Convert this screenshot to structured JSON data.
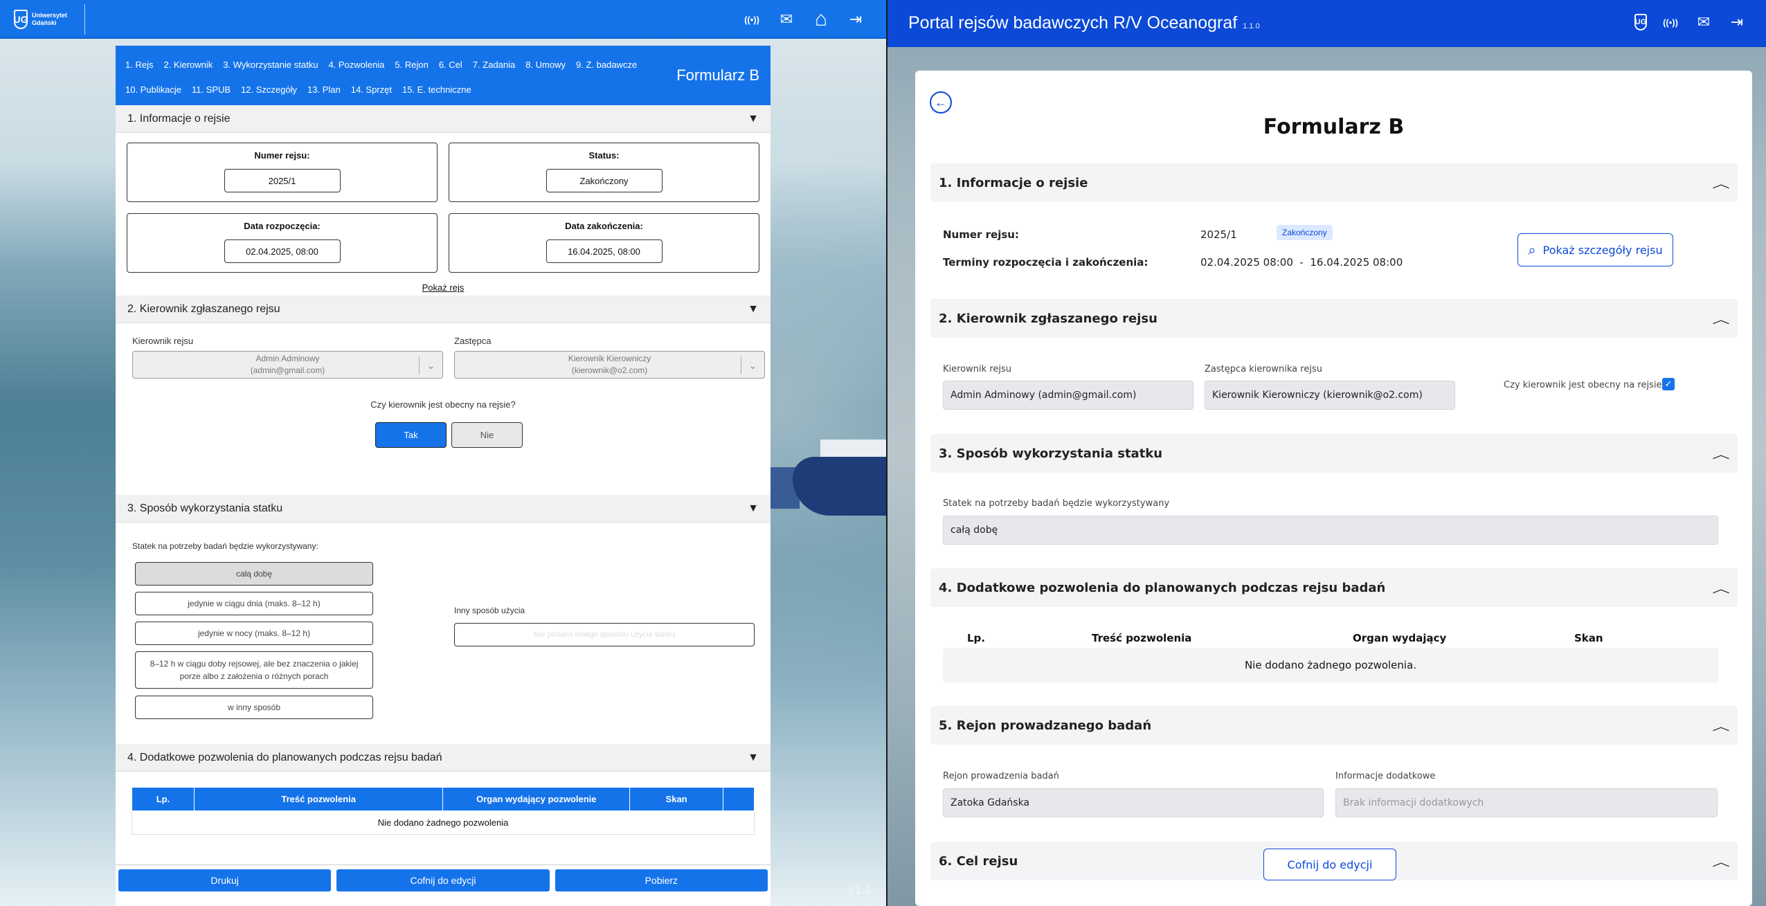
{
  "left": {
    "logo": {
      "line1": "Uniwersytet",
      "line2": "Gdański",
      "crest": "UG"
    },
    "header_icons": [
      "broadcast-icon",
      "mail-icon",
      "home-icon",
      "logout-icon"
    ],
    "header_glyphs": {
      "broadcast": "((•))",
      "mail": "✉",
      "home": "⌂",
      "logout": "⇥"
    },
    "version": "v1.1",
    "form": {
      "title": "Formularz B",
      "nav": [
        "1. Rejs",
        "2. Kierownik",
        "3. Wykorzystanie statku",
        "4. Pozwolenia",
        "5. Rejon",
        "6. Cel",
        "7. Zadania",
        "8. Umowy",
        "9. Z. badawcze",
        "10. Publikacje",
        "11. SPUB",
        "12. Szczegóły",
        "13. Plan",
        "14. Sprzęt",
        "15. E. techniczne"
      ],
      "toggle_glyph": "▼",
      "sec1": {
        "title": "1. Informacje o rejsie",
        "number_label": "Numer rejsu:",
        "number_value": "2025/1",
        "status_label": "Status:",
        "status_value": "Zakończony",
        "start_label": "Data rozpoczęcia:",
        "start_value": "02.04.2025, 08:00",
        "end_label": "Data zakończenia:",
        "end_value": "16.04.2025, 08:00",
        "show_link": "Pokaż rejs"
      },
      "sec2": {
        "title": "2. Kierownik zgłaszanego rejsu",
        "manager_label": "Kierownik rejsu",
        "manager_name": "Admin Adminowy",
        "manager_email": "(admin@gmail.com)",
        "deputy_label": "Zastępca",
        "deputy_name": "Kierownik Kierowniczy",
        "deputy_email": "(kierownik@o2.com)",
        "present_question": "Czy kierownik jest obecny na rejsie?",
        "yes": "Tak",
        "no": "Nie",
        "chevron": "⌄"
      },
      "sec3": {
        "title": "3. Sposób wykorzystania statku",
        "label": "Statek na potrzeby badań będzie wykorzystywany:",
        "options": [
          "całą dobę",
          "jedynie w ciągu dnia (maks. 8–12 h)",
          "jedynie w nocy (maks. 8–12 h)",
          "8–12 h w ciągu doby rejsowej, ale bez znaczenia o jakiej porze albo z założenia o różnych porach",
          "w inny sposób"
        ],
        "other_label": "Inny sposób użycia",
        "other_placeholder": "Nie podano innego sposobu użycia statku"
      },
      "sec4": {
        "title": "4. Dodatkowe pozwolenia do planowanych podczas rejsu badań",
        "columns": [
          "Lp.",
          "Treść pozwolenia",
          "Organ wydający pozwolenie",
          "Skan",
          ""
        ],
        "empty": "Nie dodano żadnego pozwolenia"
      },
      "footer": {
        "print": "Drukuj",
        "revert": "Cofnij do edycji",
        "download": "Pobierz"
      }
    }
  },
  "right": {
    "app_title": "Portal rejsów badawczych R/V Oceanograf",
    "app_version": "1.1.0",
    "header_icons": [
      "university-icon",
      "broadcast-icon",
      "mail-icon",
      "logout-icon"
    ],
    "header_glyphs": {
      "university": "UG",
      "broadcast": "((•))",
      "mail": "✉",
      "logout": "⇥"
    },
    "back_glyph": "←",
    "chevron_glyph": "︿",
    "page_title": "Formularz B",
    "sec1": {
      "title": "1. Informacje o rejsie",
      "number_label": "Numer rejsu:",
      "number_value": "2025/1",
      "status_badge": "Zakończony",
      "dates_label": "Terminy rozpoczęcia i zakończenia:",
      "dates_value": "02.04.2025 08:00  -  16.04.2025 08:00",
      "details_button": "Pokaż szczegóły rejsu",
      "search_glyph": "⌕"
    },
    "sec2": {
      "title": "2. Kierownik zgłaszanego rejsu",
      "manager_label": "Kierownik rejsu",
      "manager_value": "Admin Adminowy (admin@gmail.com)",
      "deputy_label": "Zastępca kierownika rejsu",
      "deputy_value": "Kierownik Kierowniczy (kierownik@o2.com)",
      "present_label": "Czy kierownik jest obecny na rejsie?",
      "present_checked": true,
      "check_glyph": "✓"
    },
    "sec3": {
      "title": "3. Sposób wykorzystania statku",
      "label": "Statek na potrzeby badań będzie wykorzystywany",
      "value": "całą dobę"
    },
    "sec4": {
      "title": "4. Dodatkowe pozwolenia do planowanych podczas rejsu badań",
      "columns": [
        "Lp.",
        "Treść pozwolenia",
        "Organ wydający",
        "Skan"
      ],
      "empty": "Nie dodano żadnego pozwolenia."
    },
    "sec5": {
      "title": "5. Rejon prowadzanego badań",
      "region_label": "Rejon prowadzenia badań",
      "region_value": "Zatoka Gdańska",
      "info_label": "Informacje dodatkowe",
      "info_placeholder": "Brak informacji dodatkowych"
    },
    "sec6": {
      "title": "6. Cel rejsu"
    },
    "revert_button": "Cofnij do edycji"
  }
}
